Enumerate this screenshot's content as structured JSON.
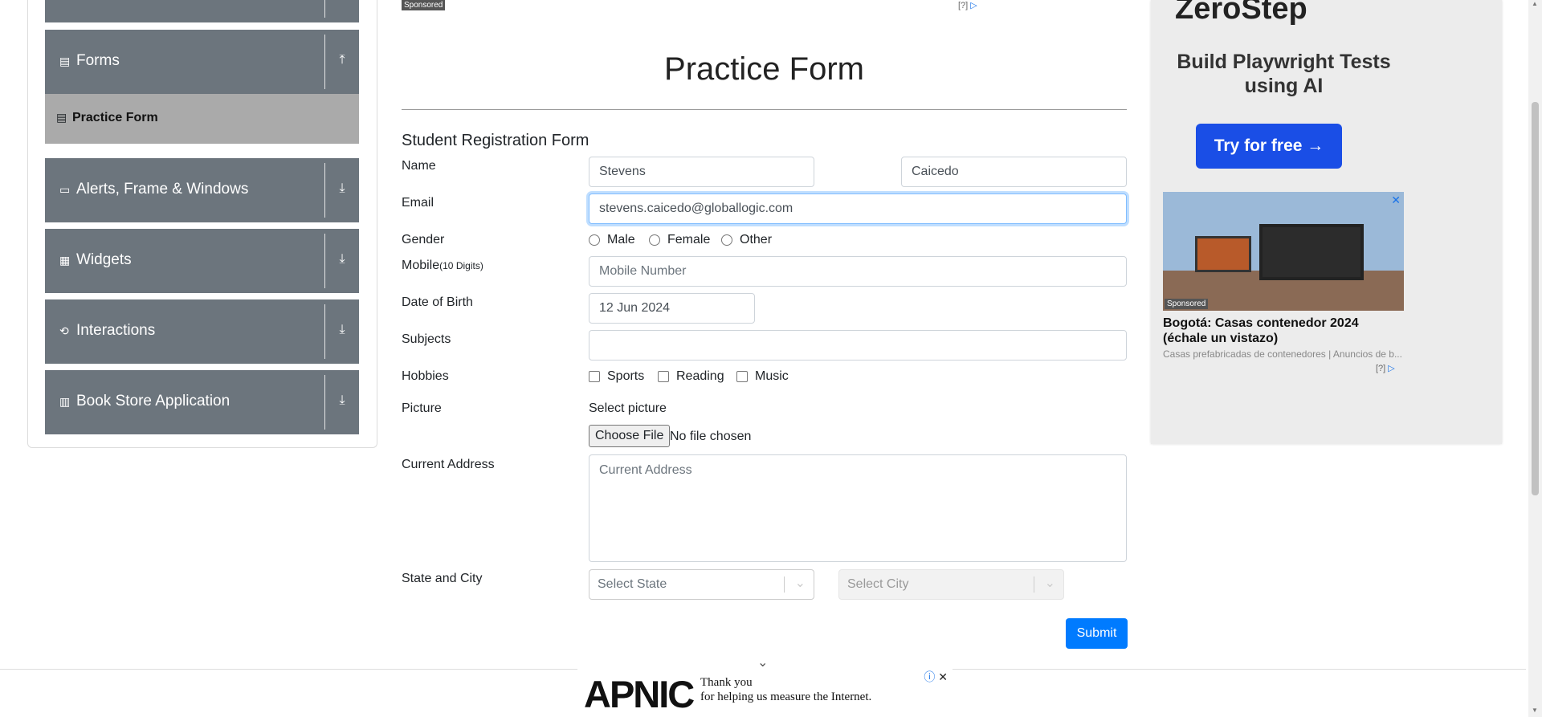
{
  "sidebar": {
    "forms": {
      "label": "Forms",
      "icon": "forms-icon",
      "arrow": "collapse-arrow-icon"
    },
    "practice_form": {
      "label": "Practice Form"
    },
    "alerts": {
      "label": "Alerts, Frame & Windows"
    },
    "widgets": {
      "label": "Widgets"
    },
    "interactions": {
      "label": "Interactions"
    },
    "book_store": {
      "label": "Book Store Application"
    }
  },
  "top_ad": {
    "sponsored": "Sponsored",
    "info": "[?]"
  },
  "form": {
    "title": "Practice Form",
    "heading": "Student Registration Form",
    "name_label": "Name",
    "first_name_value": "Stevens",
    "last_name_value": "Caicedo",
    "email_label": "Email",
    "email_value": "stevens.caicedo@globallogic.com",
    "gender_label": "Gender",
    "gender_options": [
      "Male",
      "Female",
      "Other"
    ],
    "mobile_label": "Mobile",
    "mobile_hint": "(10 Digits)",
    "mobile_placeholder": "Mobile Number",
    "dob_label": "Date of Birth",
    "dob_value": "12 Jun 2024",
    "subjects_label": "Subjects",
    "subjects_value": "",
    "hobbies_label": "Hobbies",
    "hobby_options": [
      "Sports",
      "Reading",
      "Music"
    ],
    "picture_label": "Picture",
    "select_picture": "Select picture",
    "choose_file": "Choose File",
    "no_file": "No file chosen",
    "address_label": "Current Address",
    "address_placeholder": "Current Address",
    "state_city_label": "State and City",
    "state_placeholder": "Select State",
    "city_placeholder": "Select City",
    "submit_label": "Submit"
  },
  "right_ad": {
    "brand": "ZeroStep",
    "promo": "Build Playwright Tests using AI",
    "cta": "Try for free →",
    "sponsored": "Sponsored",
    "headline": "Bogotá: Casas contenedor 2024 (échale un vistazo)",
    "subline": "Casas prefabricadas de contenedores | Anuncios de b...",
    "info": "[?]"
  },
  "bottom_ad": {
    "logo": "APNIC",
    "message_line1": "Thank you",
    "message_line2": "for helping us measure the Internet."
  },
  "colors": {
    "sidebar_group": "#6c757d",
    "sidebar_active": "#aaaaaa",
    "primary": "#007bff",
    "ad_cta": "#1a4ee6"
  }
}
